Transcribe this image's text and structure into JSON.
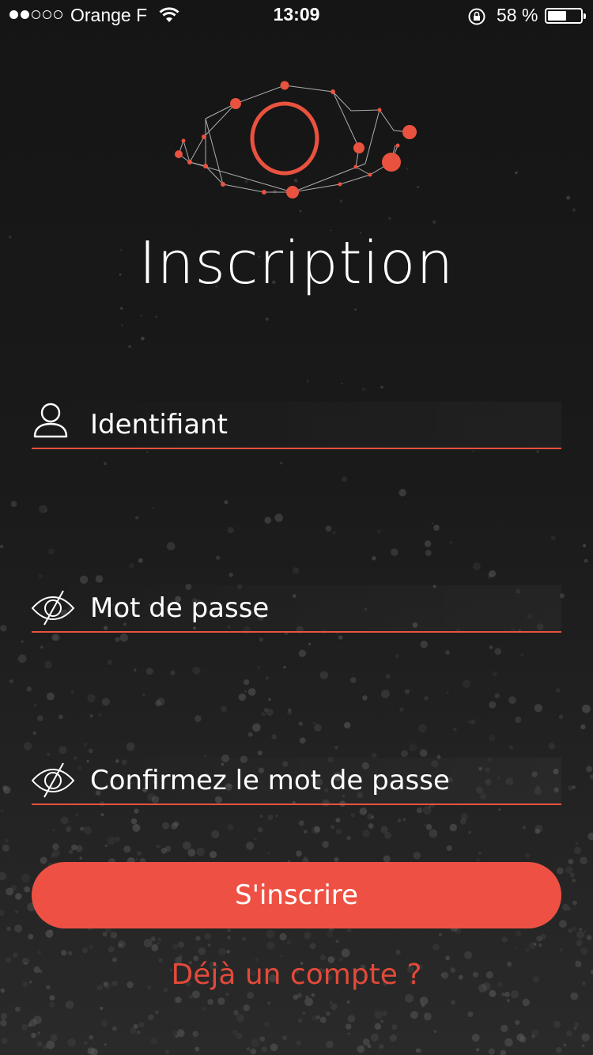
{
  "status_bar": {
    "carrier": "Orange F",
    "time": "13:09",
    "battery_text": "58 %",
    "battery_level": 0.58,
    "signal_bars_filled": 2,
    "signal_bars_total": 5
  },
  "title": "Inscription",
  "form": {
    "username_placeholder": "Identifiant",
    "password_placeholder": "Mot de passe",
    "confirm_placeholder": "Confirmez le mot de passe"
  },
  "submit_label": "S'inscrire",
  "login_link": "Déjà un compte ?",
  "icons": {
    "logo": "eye-network-logo",
    "username": "user-icon",
    "password": "eye-slash-icon",
    "confirm": "eye-slash-icon"
  },
  "colors": {
    "accent": "#ee5143",
    "background": "#151515",
    "text": "#ffffff"
  }
}
